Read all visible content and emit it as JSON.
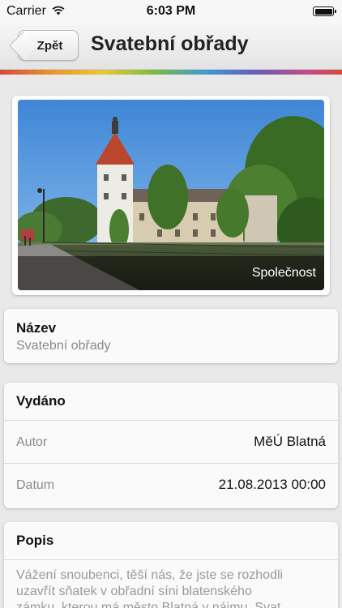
{
  "status_bar": {
    "carrier": "Carrier",
    "time": "6:03 PM"
  },
  "nav": {
    "back_label": "Zpět",
    "title": "Svatební obřady"
  },
  "photo": {
    "caption": "Společnost"
  },
  "name_card": {
    "heading": "Název",
    "value": "Svatební obřady"
  },
  "published_card": {
    "heading": "Vydáno",
    "rows": [
      {
        "label": "Autor",
        "value": "MěÚ Blatná"
      },
      {
        "label": "Datum",
        "value": "21.08.2013 00:00"
      }
    ]
  },
  "description_card": {
    "heading": "Popis",
    "lines": [
      "Vážení snoubenci, těší nás, že jste se rozhodli",
      "uzavřít sňatek v obřadní síni blatenského",
      "zámku, kterou má město Blatná v nájmu. Svat"
    ]
  },
  "colors": {
    "accent_rainbow": [
      "#d84a3c",
      "#e8932e",
      "#e6c93a",
      "#7fba3f",
      "#3f9bd1",
      "#6b5bb8",
      "#c54d88"
    ]
  }
}
